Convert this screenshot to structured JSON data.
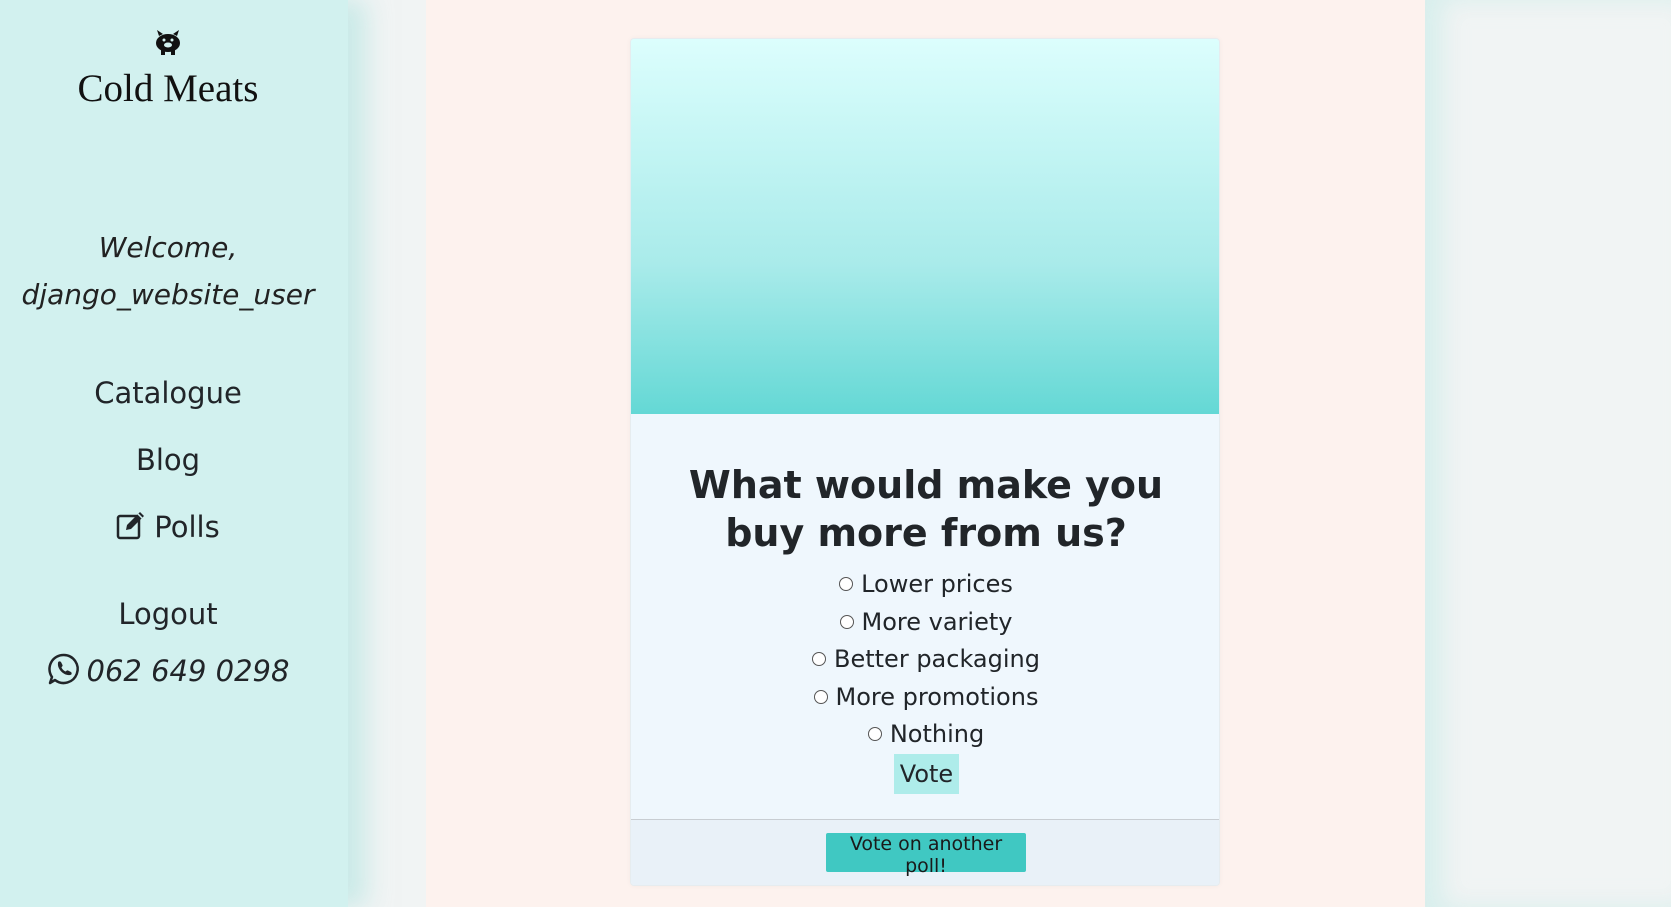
{
  "sidebar": {
    "logo_icon": "pig-icon",
    "brand": "Cold Meats",
    "welcome_line1": "Welcome,",
    "welcome_line2": "django_website_user",
    "nav": {
      "catalogue": "Catalogue",
      "blog": "Blog",
      "polls": "Polls",
      "polls_icon": "edit-icon",
      "logout": "Logout"
    },
    "phone": "062 649 0298",
    "phone_icon": "whatsapp-icon"
  },
  "poll": {
    "question": "What would make you buy more from us?",
    "choices": [
      "Lower prices",
      "More variety",
      "Better packaging",
      "More promotions",
      "Nothing"
    ],
    "vote_label": "Vote",
    "another_label": "Vote on another poll!"
  },
  "colors": {
    "sidebar_bg": "#d2f1ef",
    "content_bg": "#fdf2ee",
    "card_bg": "#eff7fd",
    "banner_top": "#dcfefd",
    "banner_bottom": "#64d8d5",
    "vote_button": "#aeecea",
    "another_button": "#40c8c2"
  }
}
